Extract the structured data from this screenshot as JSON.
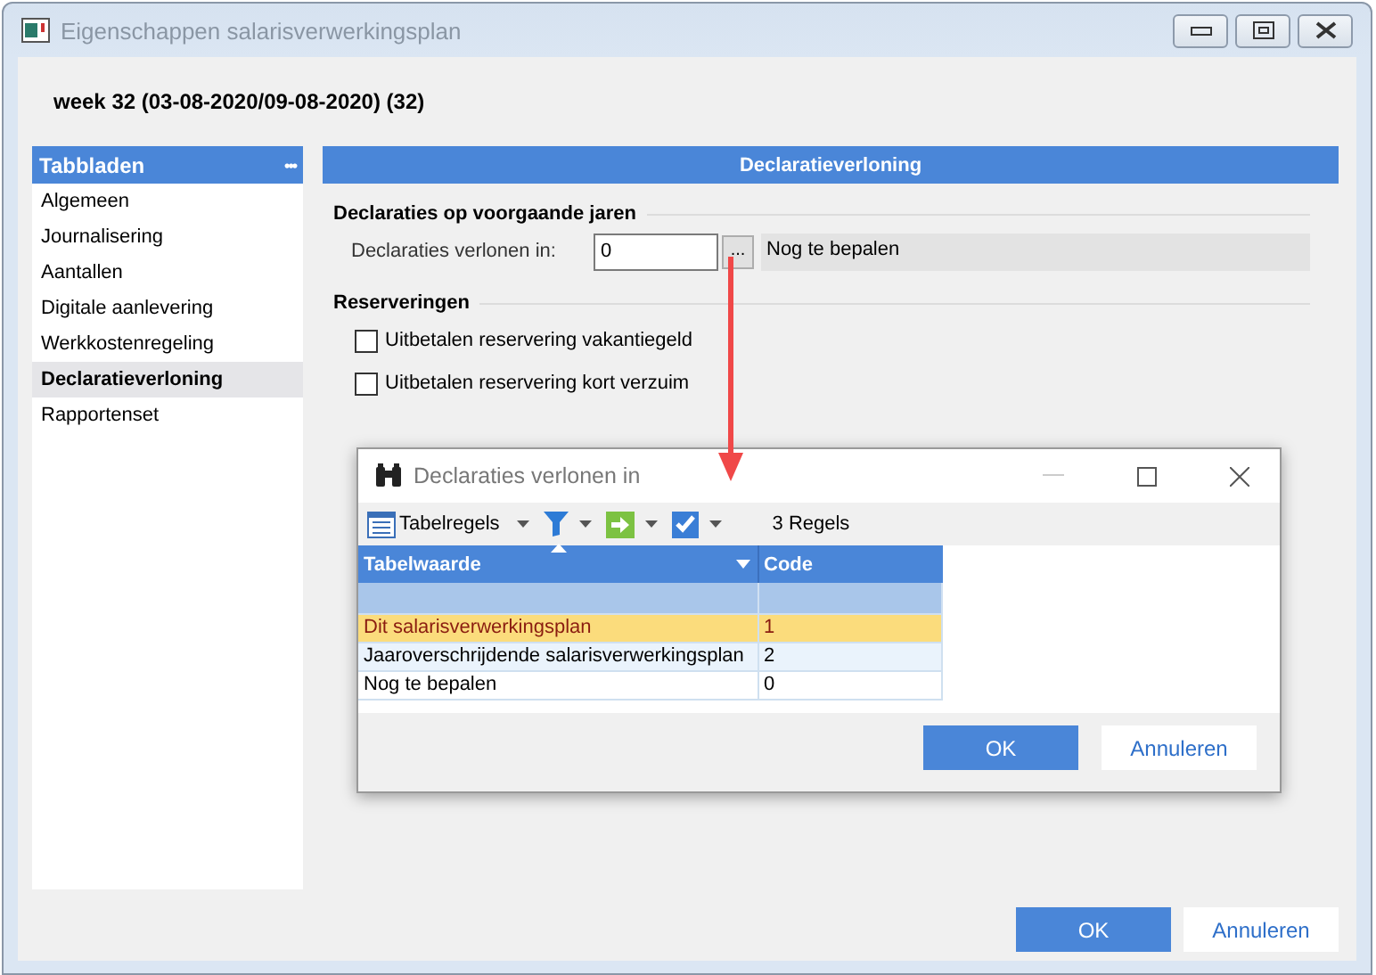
{
  "window": {
    "title": "Eigenschappen salarisverwerkingsplan"
  },
  "heading": "week 32 (03-08-2020/09-08-2020) (32)",
  "sidebar": {
    "title": "Tabbladen",
    "menu": "•••",
    "items": [
      {
        "label": "Algemeen",
        "selected": false
      },
      {
        "label": "Journalisering",
        "selected": false
      },
      {
        "label": "Aantallen",
        "selected": false
      },
      {
        "label": "Digitale aanlevering",
        "selected": false
      },
      {
        "label": "Werkkostenregeling",
        "selected": false
      },
      {
        "label": "Declaratieverloning",
        "selected": true
      },
      {
        "label": "Rapportenset",
        "selected": false
      }
    ]
  },
  "panel": {
    "title": "Declaratieverloning",
    "sections": [
      {
        "title": "Declaraties op voorgaande jaren",
        "kind": "lookup",
        "label": "Declaraties verlonen in:",
        "value": "0",
        "browse": "...",
        "description": "Nog te bepalen"
      },
      {
        "title": "Reserveringen",
        "kind": "checkboxes",
        "checkboxes": [
          {
            "label": "Uitbetalen reservering vakantiegeld",
            "checked": false
          },
          {
            "label": "Uitbetalen reservering kort verzuim",
            "checked": false
          }
        ]
      }
    ]
  },
  "buttons": [
    {
      "label": "OK",
      "kind": "primary"
    },
    {
      "label": "Annuleren",
      "kind": "secondary"
    }
  ],
  "dialog": {
    "title": "Declaraties verlonen in",
    "toolbar": [
      {
        "kind": "table",
        "label": "Tabelregels"
      },
      {
        "kind": "filter"
      },
      {
        "kind": "export"
      },
      {
        "kind": "check"
      }
    ],
    "count": "3 Regels",
    "columns": [
      "Tabelwaarde",
      "Code"
    ],
    "rows": [
      {
        "cells": [
          "Dit salarisverwerkingsplan",
          "1"
        ],
        "selected": true
      },
      {
        "cells": [
          "Jaaroverschrijdende salarisverwerkingsplan",
          "2"
        ],
        "selected": false
      },
      {
        "cells": [
          "Nog te bepalen",
          "0"
        ],
        "selected": false
      }
    ],
    "buttons": [
      {
        "label": "OK",
        "kind": "primary"
      },
      {
        "label": "Annuleren",
        "kind": "secondary"
      }
    ]
  }
}
